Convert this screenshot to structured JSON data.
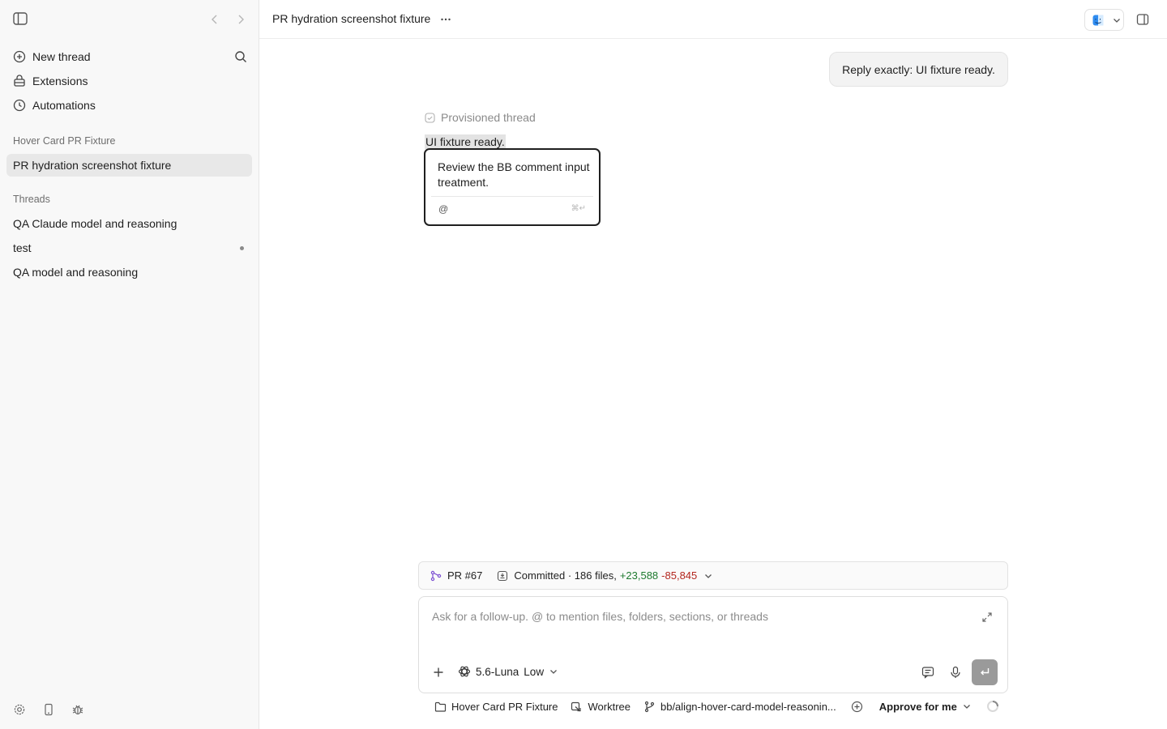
{
  "sidebar": {
    "actions": [
      {
        "label": "New thread",
        "icon": "plus-circle-icon"
      },
      {
        "label": "Extensions",
        "icon": "extensions-icon"
      },
      {
        "label": "Automations",
        "icon": "clock-icon"
      }
    ],
    "project_section": "Hover Card PR Fixture",
    "project_threads": [
      "PR hydration screenshot fixture"
    ],
    "threads_section": "Threads",
    "threads": [
      "QA Claude model and reasoning",
      "test",
      "QA model and reasoning"
    ]
  },
  "topbar": {
    "title": "PR hydration screenshot fixture"
  },
  "conversation": {
    "user_message": "Reply exactly: UI fixture ready.",
    "status": "Provisioned thread",
    "assistant_reply": "UI fixture ready.",
    "comment": {
      "text": "Review the BB comment input treatment.",
      "mention_symbol": "@",
      "submit_hint": "⌘↵"
    }
  },
  "pr_bar": {
    "pr": "PR #67",
    "committed": "Committed · 186 files,",
    "additions": "+23,588",
    "deletions": "-85,845"
  },
  "composer": {
    "placeholder": "Ask for a follow-up. @ to mention files, folders, sections, or threads",
    "model": "5.6-Luna",
    "reasoning": "Low"
  },
  "footer": {
    "project": "Hover Card PR Fixture",
    "worktree": "Worktree",
    "branch": "bb/align-hover-card-model-reasonin...",
    "approval": "Approve for me"
  },
  "colors": {
    "additions": "#1e7a2f",
    "deletions": "#b3261e",
    "active_thread_bg": "#e8e8e8"
  }
}
